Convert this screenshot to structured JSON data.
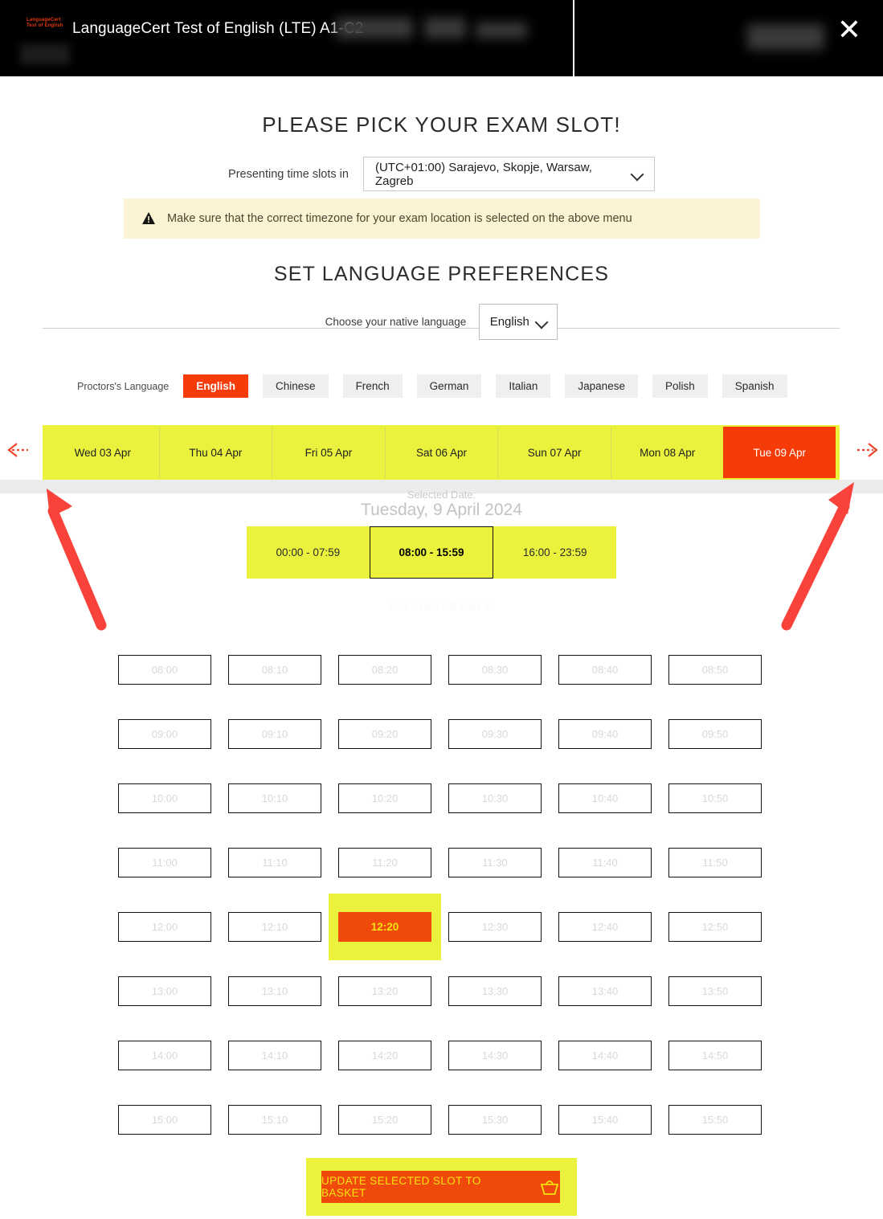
{
  "header": {
    "logo_line1": "LanguageCert",
    "logo_line2": "Test of English",
    "title": "LanguageCert Test of English (LTE) A1-C2",
    "close_label": "✕"
  },
  "main": {
    "heading": "PLEASE PICK YOUR EXAM SLOT!",
    "timezone_label": "Presenting time slots in",
    "timezone_value": "(UTC+01:00) Sarajevo, Skopje, Warsaw, Zagreb",
    "warning_text": "Make sure that the correct timezone for your exam location is selected on the above menu",
    "warning_icon": "⚠",
    "language_heading": "SET LANGUAGE PREFERENCES",
    "native_label": "Choose your native language",
    "native_value": "English",
    "proctor_label": "Proctors's Language",
    "proctor_languages": [
      "English",
      "Chinese",
      "French",
      "German",
      "Italian",
      "Japanese",
      "Polish",
      "Spanish"
    ],
    "proctor_selected": "English"
  },
  "dates": {
    "prev_arrow": "⇠",
    "next_arrow": "⇢",
    "items": [
      "Wed 03 Apr",
      "Thu 04 Apr",
      "Fri 05 Apr",
      "Sat 06 Apr",
      "Sun 07 Apr",
      "Mon 08 Apr",
      "Tue 09 Apr"
    ],
    "selected": "Tue 09 Apr",
    "selected_date_label": "Selected Date:",
    "selected_date_value": "Tuesday, 9 April 2024"
  },
  "periods": {
    "items": [
      "00:00 - 07:59",
      "08:00 - 15:59",
      "16:00 - 23:59"
    ],
    "selected": "08:00 - 15:59",
    "start_at_label": "Your exam will start at:"
  },
  "slots": {
    "times": [
      "08:00",
      "08:10",
      "08:20",
      "08:30",
      "08:40",
      "08:50",
      "09:00",
      "09:10",
      "09:20",
      "09:30",
      "09:40",
      "09:50",
      "10:00",
      "10:10",
      "10:20",
      "10:30",
      "10:40",
      "10:50",
      "11:00",
      "11:10",
      "11:20",
      "11:30",
      "11:40",
      "11:50",
      "12:00",
      "12:10",
      "12:20",
      "12:30",
      "12:40",
      "12:50",
      "13:00",
      "13:10",
      "13:20",
      "13:30",
      "13:40",
      "13:50",
      "14:00",
      "14:10",
      "14:20",
      "14:30",
      "14:40",
      "14:50",
      "15:00",
      "15:10",
      "15:20",
      "15:30",
      "15:40",
      "15:50"
    ],
    "selected": "12:20"
  },
  "footer": {
    "basket_label": "UPDATE SELECTED SLOT TO BASKET",
    "basket_icon": "basket-icon"
  },
  "colors": {
    "accent_orange": "#ef4a0c",
    "brand_red": "#f53b07",
    "highlight_yellow": "#eaf23e",
    "warning_bg": "#fcf3d4",
    "annotation_red": "#f9423a"
  }
}
